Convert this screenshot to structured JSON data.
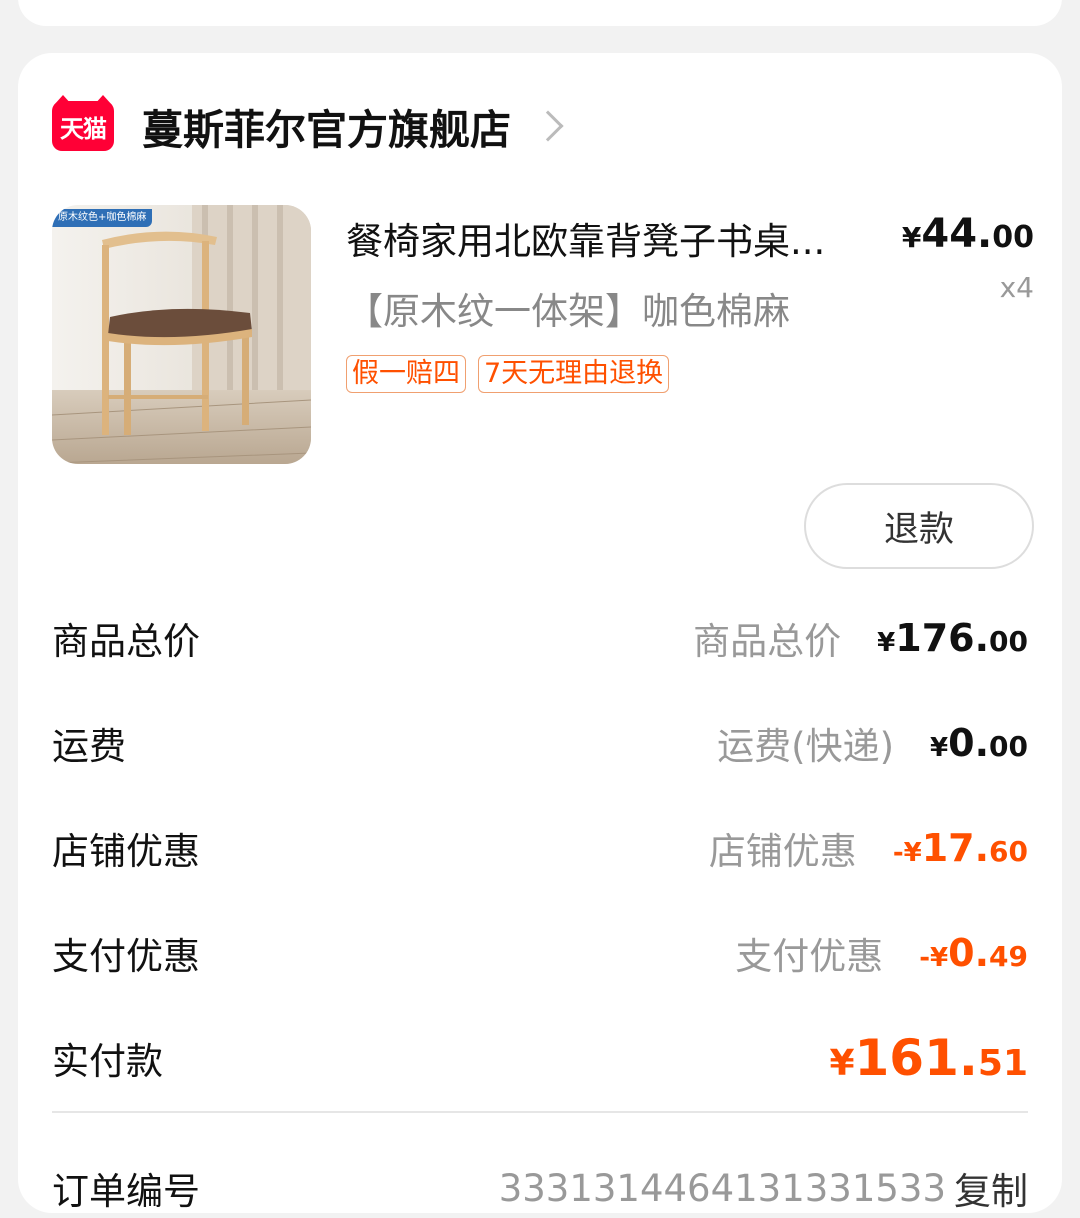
{
  "shop": {
    "badge": "天猫",
    "name": "蔓斯菲尔官方旗舰店"
  },
  "product": {
    "thumb_tag": "原木纹色+咖色棉麻",
    "title": "餐椅家用北欧靠背凳子书桌...",
    "sku": "【原木纹一体架】咖色棉麻",
    "tags": [
      "假一赔四",
      "7天无理由退换"
    ],
    "price_symbol": "¥",
    "price_int": "44.",
    "price_dec": "00",
    "qty": "x4"
  },
  "actions": {
    "refund_label": "退款"
  },
  "summary": {
    "rows": [
      {
        "label": "商品总价",
        "sub": "商品总价",
        "sign": "",
        "symbol": "¥",
        "int": "176.",
        "dec": "00"
      },
      {
        "label": "运费",
        "sub": "运费(快递)",
        "sign": "",
        "symbol": "¥",
        "int": "0.",
        "dec": "00"
      },
      {
        "label": "店铺优惠",
        "sub": "店铺优惠",
        "sign": "-",
        "symbol": "¥",
        "int": "17.",
        "dec": "60"
      },
      {
        "label": "支付优惠",
        "sub": "支付优惠",
        "sign": "-",
        "symbol": "¥",
        "int": "0.",
        "dec": "49"
      }
    ],
    "paid": {
      "label": "实付款",
      "symbol": "¥",
      "int": "161.",
      "dec": "51"
    }
  },
  "order": {
    "label": "订单编号",
    "number": "3331314464131331533",
    "copy_label": "复制"
  },
  "colors": {
    "accent": "#ff5000",
    "tmall_red": "#ff0036"
  }
}
